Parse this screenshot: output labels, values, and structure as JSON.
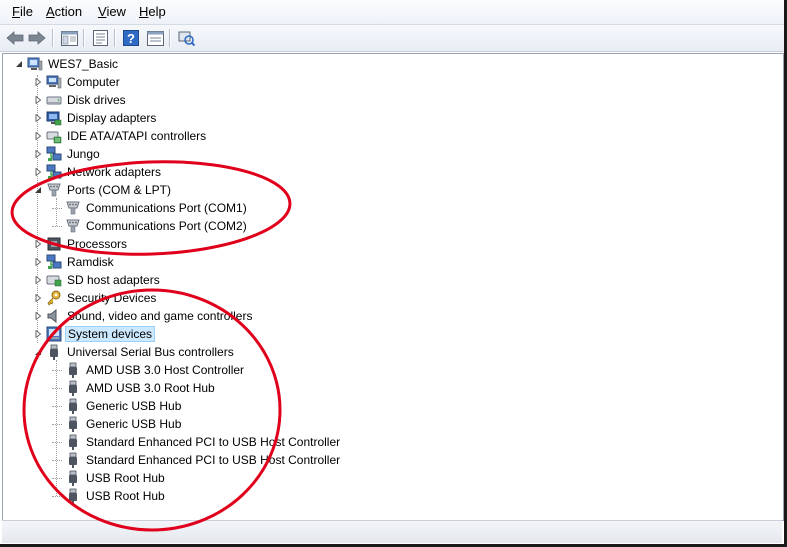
{
  "menu": {
    "file": {
      "acc": "F",
      "rest": "ile"
    },
    "action": {
      "acc": "A",
      "rest": "ction"
    },
    "view": {
      "acc": "V",
      "rest": "iew"
    },
    "help": {
      "acc": "H",
      "rest": "elp"
    }
  },
  "tree": {
    "root": "WES7_Basic",
    "categories": [
      {
        "label": "Computer",
        "icon": "computer-icon"
      },
      {
        "label": "Disk drives",
        "icon": "disk-drive-icon"
      },
      {
        "label": "Display adapters",
        "icon": "display-adapter-icon"
      },
      {
        "label": "IDE ATA/ATAPI controllers",
        "icon": "ide-controller-icon"
      },
      {
        "label": "Jungo",
        "icon": "network-icon"
      },
      {
        "label": "Network adapters",
        "icon": "network-icon"
      },
      {
        "label": "Ports (COM & LPT)",
        "icon": "port-icon"
      },
      {
        "label": "Processors",
        "icon": "processor-icon"
      },
      {
        "label": "Ramdisk",
        "icon": "network-icon"
      },
      {
        "label": "SD host adapters",
        "icon": "sd-host-icon"
      },
      {
        "label": "Security Devices",
        "icon": "key-icon"
      },
      {
        "label": "Sound, video and game controllers",
        "icon": "speaker-icon"
      },
      {
        "label": "System devices",
        "icon": "system-devices-icon"
      },
      {
        "label": "Universal Serial Bus controllers",
        "icon": "usb-icon"
      }
    ],
    "ports_children": [
      "Communications Port (COM1)",
      "Communications Port (COM2)"
    ],
    "usb_children": [
      "AMD USB 3.0 Host Controller",
      "AMD USB 3.0 Root Hub",
      "Generic USB Hub",
      "Generic USB Hub",
      "Standard Enhanced PCI to USB Host Controller",
      "Standard Enhanced PCI to USB Host Controller",
      "USB Root Hub",
      "USB Root Hub"
    ]
  },
  "annotation_color": "#e0001b",
  "selection_color": "#cce8ff"
}
